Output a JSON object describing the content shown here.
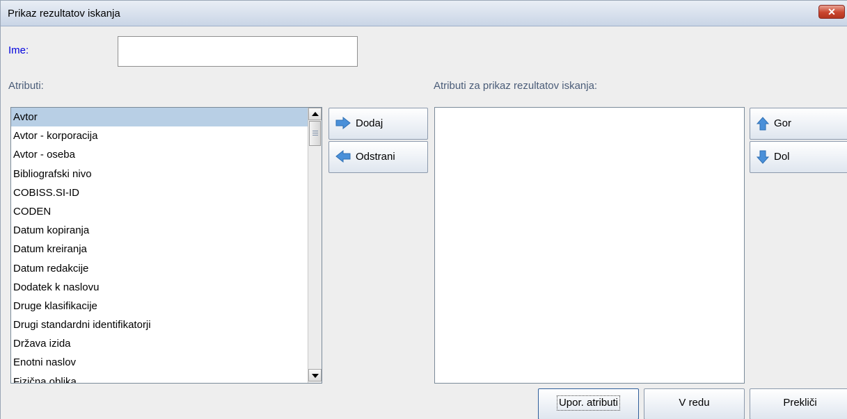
{
  "window": {
    "title": "Prikaz rezultatov iskanja",
    "close_label": "✕"
  },
  "name": {
    "label": "Ime:",
    "value": ""
  },
  "attributes": {
    "label": "Atributi:",
    "items": [
      "Avtor",
      "Avtor - korporacija",
      "Avtor - oseba",
      "Bibliografski nivo",
      "COBISS.SI-ID",
      "CODEN",
      "Datum kopiranja",
      "Datum kreiranja",
      "Datum redakcije",
      "Dodatek k naslovu",
      "Druge klasifikacije",
      "Drugi standardni identifikatorji",
      "Država izida",
      "Enotni naslov",
      "Fizična oblika"
    ],
    "selected_index": 0
  },
  "display_attributes": {
    "label": "Atributi za prikaz rezultatov iskanja:",
    "items": []
  },
  "buttons": {
    "add": "Dodaj",
    "remove": "Odstrani",
    "up": "Gor",
    "down": "Dol",
    "used_attributes": "Upor. atributi",
    "ok": "V redu",
    "cancel": "Prekliči"
  },
  "icons": {
    "add": "arrow-right-icon",
    "remove": "arrow-left-icon",
    "up": "arrow-up-icon",
    "down": "arrow-down-icon"
  },
  "colors": {
    "arrow_icon": "#4a90d9",
    "label_blue": "#0000dd",
    "selection": "#b8cfe5"
  }
}
